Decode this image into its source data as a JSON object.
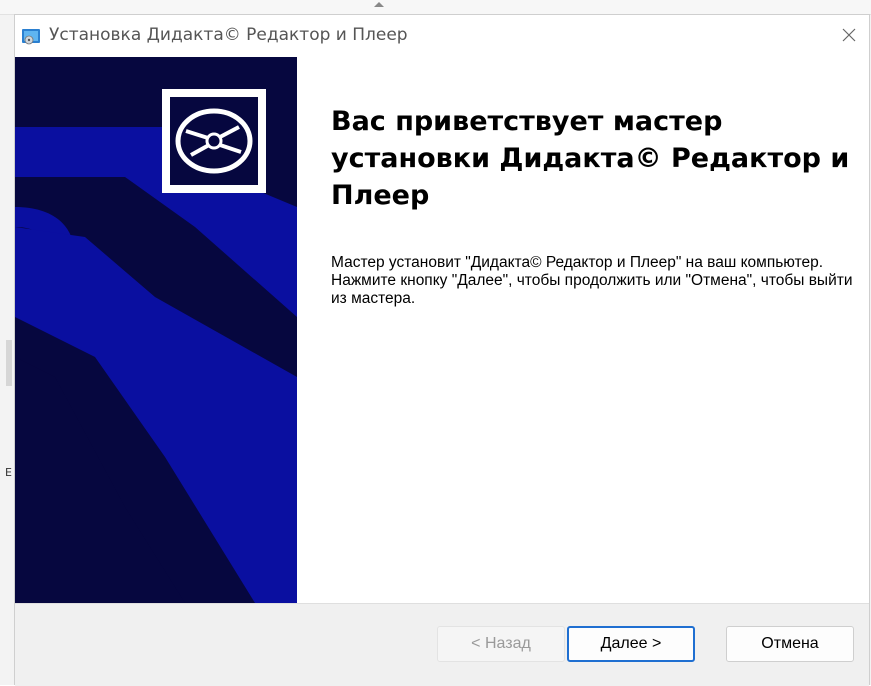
{
  "window": {
    "title": "Установка Дидакта© Редактор и Плеер",
    "close_icon": "close-icon",
    "app_icon": "installer-icon"
  },
  "banner": {
    "disc_icon": "disc-icon",
    "colors": {
      "dark": "#06073f",
      "light": "#0a0fa0",
      "frame": "#ffffff"
    }
  },
  "content": {
    "heading": "Вас приветствует мастер установки Дидакта© Редактор и Плеер",
    "description": "Мастер установит \"Дидакта© Редактор и Плеер\" на ваш компьютер. Нажмите кнопку \"Далее\", чтобы продолжить или \"Отмена\", чтобы выйти из мастера."
  },
  "buttons": {
    "back": "< Назад",
    "next": "Далее >",
    "cancel": "Отмена"
  },
  "colors": {
    "accent": "#1f6fd1",
    "footer_bg": "#f0f0f0"
  }
}
